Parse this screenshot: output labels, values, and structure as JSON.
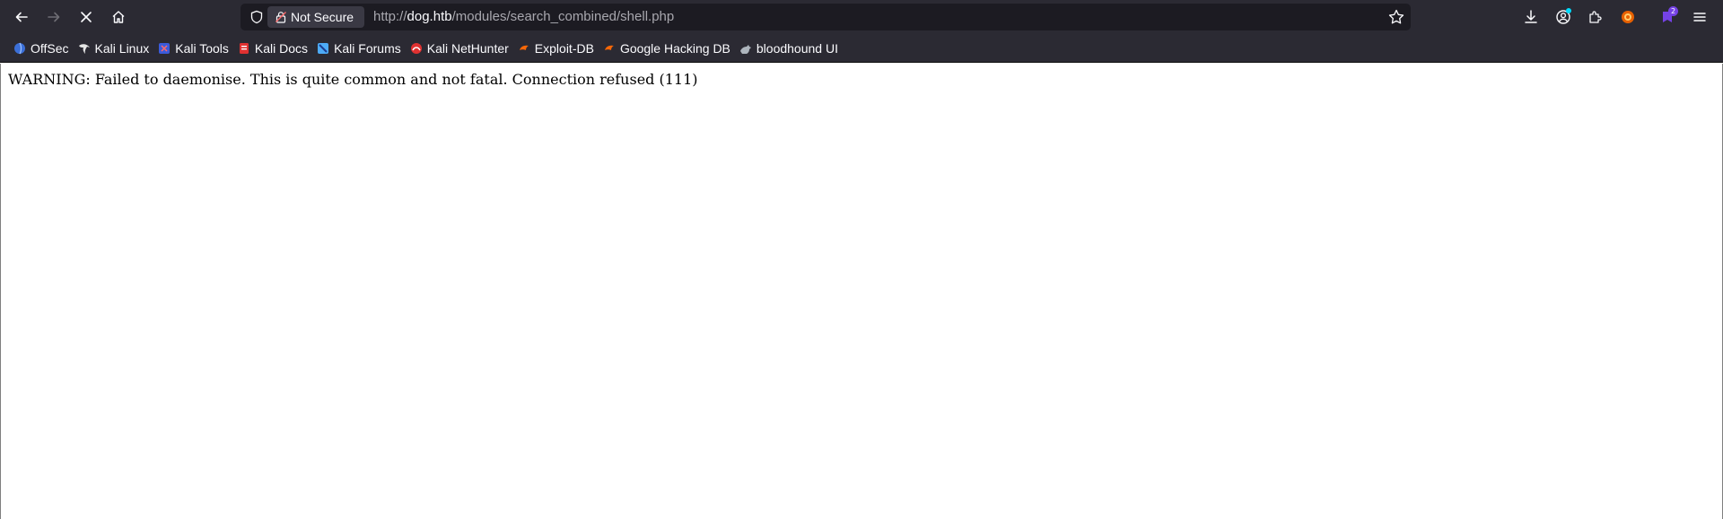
{
  "toolbar": {
    "back_icon": "arrow-left-icon",
    "forward_icon": "arrow-right-icon",
    "stop_icon": "close-icon",
    "home_icon": "home-icon"
  },
  "url_bar": {
    "security_label": "Not Secure",
    "url_prefix": "http://",
    "url_host": "dog.htb",
    "url_path": "/modules/search_combined/shell.php"
  },
  "right_toolbar": {
    "extensions_badge": "2"
  },
  "bookmarks": [
    {
      "label": "OffSec",
      "icon": "offsec-icon"
    },
    {
      "label": "Kali Linux",
      "icon": "kali-dragon-icon"
    },
    {
      "label": "Kali Tools",
      "icon": "kali-tools-icon"
    },
    {
      "label": "Kali Docs",
      "icon": "kali-docs-icon"
    },
    {
      "label": "Kali Forums",
      "icon": "kali-forums-icon"
    },
    {
      "label": "Kali NetHunter",
      "icon": "nethunter-icon"
    },
    {
      "label": "Exploit-DB",
      "icon": "exploit-db-icon"
    },
    {
      "label": "Google Hacking DB",
      "icon": "ghdb-icon"
    },
    {
      "label": "bloodhound UI",
      "icon": "bloodhound-icon"
    }
  ],
  "page": {
    "message": "WARNING: Failed to daemonise.  This is quite common and not fatal. Connection refused (111)"
  },
  "colors": {
    "chrome_bg": "#2b2a33",
    "url_bg": "#1c1b22",
    "text_light": "#fbfbfe",
    "url_dim": "#a8a7ae",
    "badge_purple": "#7542e5"
  }
}
